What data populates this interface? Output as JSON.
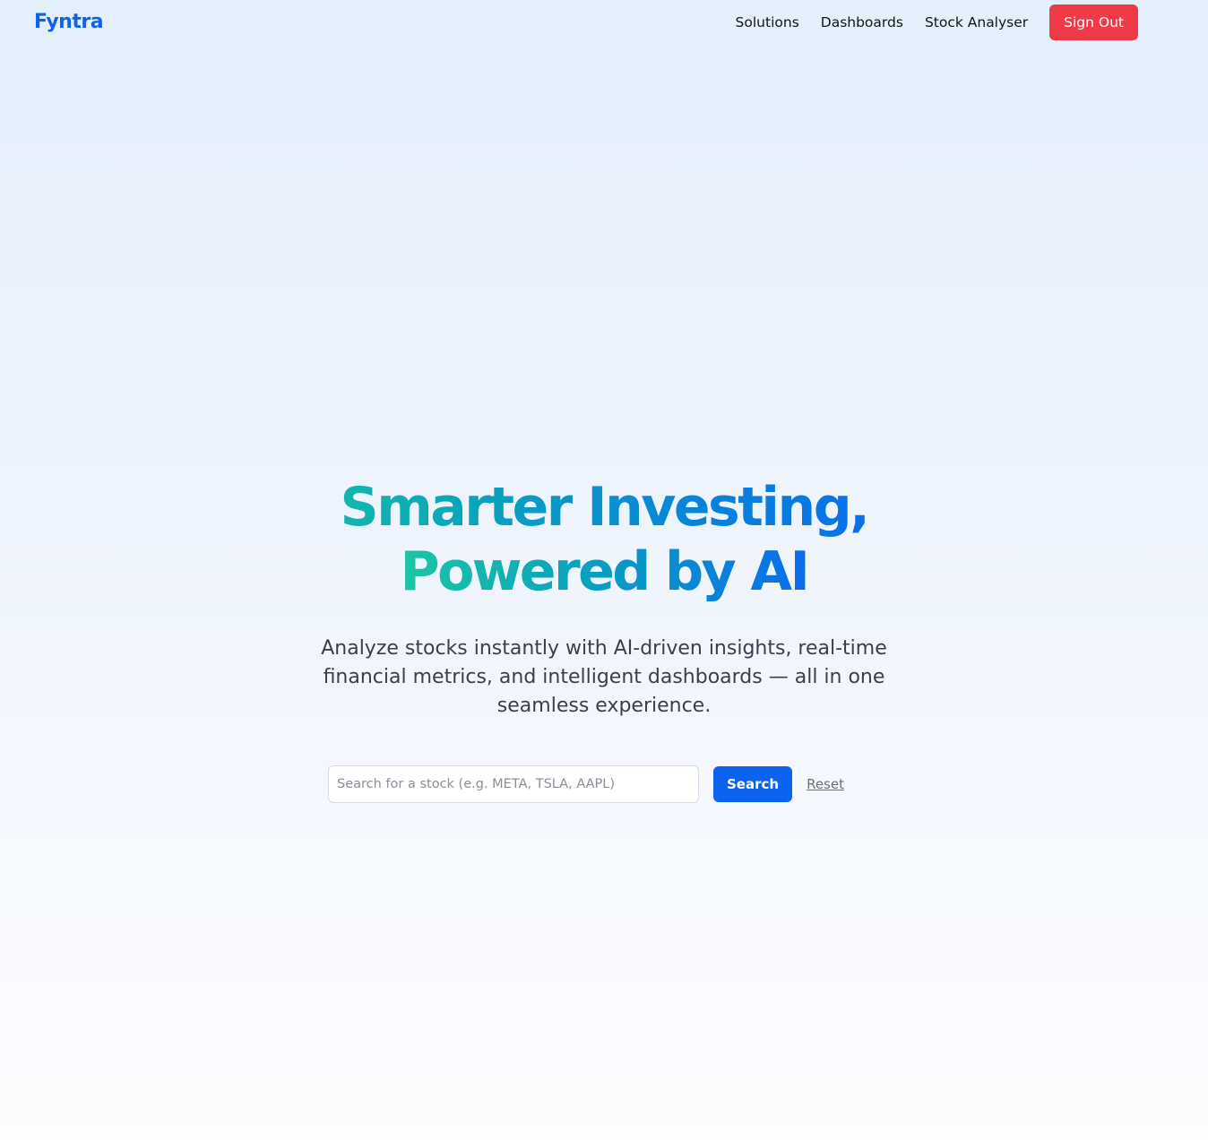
{
  "navbar": {
    "logo": "Fyntra",
    "links": [
      "Solutions",
      "Dashboards",
      "Stock Analyser"
    ],
    "signout_label": "Sign Out"
  },
  "hero": {
    "title_line1": "Smarter Investing,",
    "title_line2": "Powered by AI",
    "subtitle": "Analyze stocks instantly with AI-driven insights, real-time financial metrics, and intelligent dashboards — all in one seamless experience."
  },
  "search": {
    "placeholder": "Search for a stock (e.g. META, TSLA, AAPL)",
    "value": "",
    "button_label": "Search",
    "reset_label": "Reset"
  },
  "colors": {
    "brand": "#0b63f0",
    "signout": "#ef3a48",
    "gradient_start": "#1ec9a0",
    "gradient_end": "#0a62f5"
  }
}
